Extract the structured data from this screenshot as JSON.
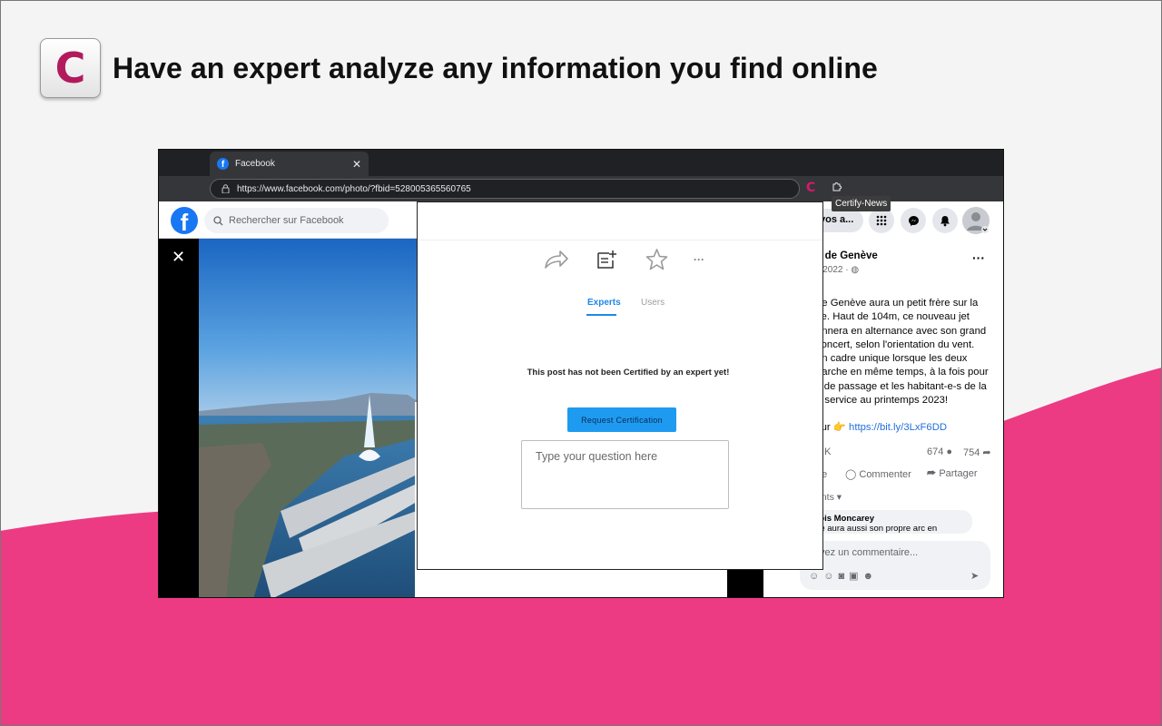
{
  "headline": {
    "logo_letter": "C",
    "text": "Have an expert analyze any information you find online"
  },
  "colors": {
    "brand": "#d6196b",
    "wave": "#ec3b83",
    "facebook": "#1877f2",
    "accent_blue": "#1e88e5"
  },
  "browser": {
    "tab_title": "Facebook",
    "tab_close": "✕",
    "url": "https://www.facebook.com/photo/?fbid=528005365560765",
    "extension_letter": "C",
    "tooltip": "Certify-News"
  },
  "facebook": {
    "logo_letter": "f",
    "search_placeholder": "Rechercher sur Facebook",
    "photo_close": "✕",
    "sidebar": {
      "pill_label": "vos a...",
      "page_name": "e de Genève",
      "post_date": "il 2022 · ",
      "more": "···",
      "post_lines": [
        "de Genève aura un petit frère sur la",
        "ite. Haut de 104m, ce nouveau jet",
        "onnera en alternance avec son grand",
        "concert, selon l'orientation du vent.",
        "un cadre unique lorsque les deux",
        "narche en même temps, à la fois pour",
        "s de passage et les habitant-e-s de la",
        "n service au printemps 2023!"
      ],
      "link_prefix": "sur 👉",
      "link": "https://bit.ly/3LxF6DD",
      "reactions": "3 K",
      "comments_count": "674",
      "shares_count": "754",
      "like_label": "ne",
      "comment_label": "Commenter",
      "share_label": "Partager",
      "sort_label": "ents",
      "commenter": "çois Moncarey",
      "comment_text": "ille aura aussi son propre arc en",
      "comment_placeholder": "vez un commentaire..."
    }
  },
  "panel": {
    "more": "···",
    "tabs": [
      {
        "label": "Experts",
        "active": true
      },
      {
        "label": "Users",
        "active": false
      }
    ],
    "status": "This post has not been Certified by an expert yet!",
    "request_button": "Request Certification",
    "question_placeholder": "Type your question here"
  }
}
